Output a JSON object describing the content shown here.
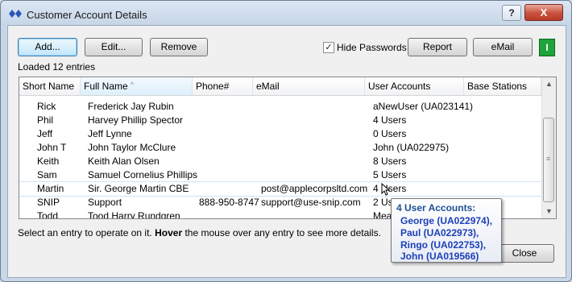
{
  "window": {
    "title": "Customer Account Details",
    "help": "?",
    "close": "X"
  },
  "toolbar": {
    "add": "Add...",
    "edit": "Edit...",
    "remove": "Remove",
    "hide_passwords": "Hide Passwords",
    "hide_passwords_checked": true,
    "report": "Report",
    "email": "eMail",
    "indicator": "I",
    "indicator_color": "#1fa33b"
  },
  "status": {
    "loaded": "Loaded 12 entries"
  },
  "columns": [
    "Short Name",
    "Full Name",
    "Phone#",
    "eMail",
    "User Accounts",
    "Base Stations"
  ],
  "rows": [
    {
      "short": "Rick",
      "full": "Frederick Jay Rubin",
      "phone": "",
      "email": "",
      "accounts": "aNewUser (UA023141)",
      "base": ""
    },
    {
      "short": "Phil",
      "full": "Harvey Phillip Spector",
      "phone": "",
      "email": "",
      "accounts": "4 Users",
      "base": ""
    },
    {
      "short": "Jeff",
      "full": "Jeff  Lynne",
      "phone": "",
      "email": "",
      "accounts": "0 Users",
      "base": ""
    },
    {
      "short": "John T",
      "full": "John Taylor  McClure",
      "phone": "",
      "email": "",
      "accounts": "John (UA022975)",
      "base": ""
    },
    {
      "short": "Keith",
      "full": "Keith Alan Olsen",
      "phone": "",
      "email": "",
      "accounts": "8 Users",
      "base": ""
    },
    {
      "short": "Sam",
      "full": "Samuel Cornelius Phillips",
      "phone": "",
      "email": "",
      "accounts": "5 Users",
      "base": ""
    },
    {
      "short": "Martin",
      "full": "Sir. George Martin  CBE",
      "phone": "",
      "email": "post@applecorpsltd.com",
      "accounts": "4 Users",
      "base": ""
    },
    {
      "short": "SNIP",
      "full": "Support",
      "phone": "888-950-8747",
      "email": "support@use-snip.com",
      "accounts": "2 Users",
      "base": ""
    },
    {
      "short": "Todd",
      "full": "Tood Harry Rundgren",
      "phone": "",
      "email": "",
      "accounts": "MeatL",
      "base": ""
    }
  ],
  "hint": {
    "part1": "Select an entry to operate on it. ",
    "bold": "Hover",
    "part2": " the mouse over any entry to see more details."
  },
  "tooltip": {
    "title": "4 User Accounts:",
    "items": [
      "George (UA022974),",
      "Paul (UA022973),",
      "Ringo (UA022753),",
      "John (UA019566)"
    ]
  },
  "footer": {
    "close": "Close"
  },
  "colors": {
    "accent": "#1c3fb8",
    "tooltip_title": "#1e4f95"
  }
}
